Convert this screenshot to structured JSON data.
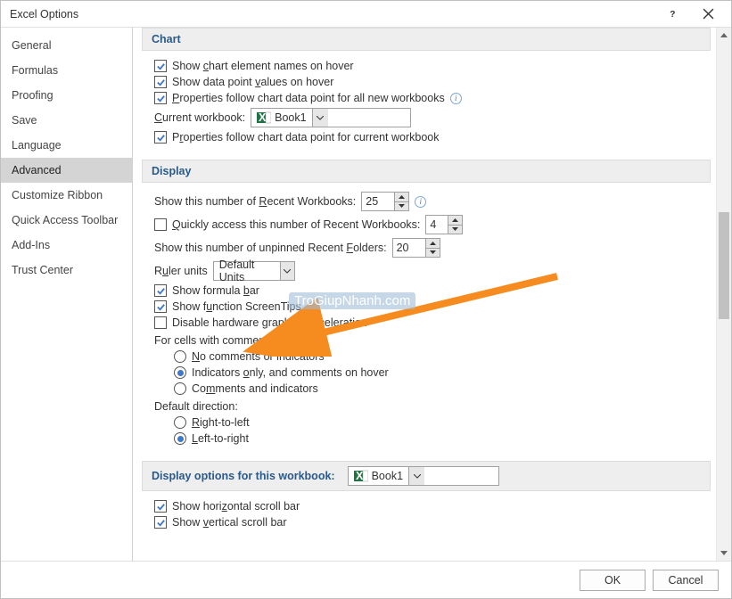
{
  "title": "Excel Options",
  "help_aria": "Help",
  "close_aria": "Close",
  "sidebar": {
    "items": [
      {
        "label": "General"
      },
      {
        "label": "Formulas"
      },
      {
        "label": "Proofing"
      },
      {
        "label": "Save"
      },
      {
        "label": "Language"
      },
      {
        "label": "Advanced"
      },
      {
        "label": "Customize Ribbon"
      },
      {
        "label": "Quick Access Toolbar"
      },
      {
        "label": "Add-Ins"
      },
      {
        "label": "Trust Center"
      }
    ],
    "selected_index": 5
  },
  "chart": {
    "header": "Chart",
    "show_names_pre": "Show ",
    "show_names_u": "c",
    "show_names_post": "hart element names on hover",
    "show_values_pre": "Show data point ",
    "show_values_u": "v",
    "show_values_post": "alues on hover",
    "props_all_pre": "",
    "props_all_u": "P",
    "props_all_post": "roperties follow chart data point for all new workbooks",
    "current_wb_pre": "",
    "current_wb_u": "C",
    "current_wb_post": "urrent workbook:",
    "current_wb_value": "Book1",
    "props_cur_pre": "P",
    "props_cur_u": "r",
    "props_cur_post": "operties follow chart data point for current workbook"
  },
  "display": {
    "header": "Display",
    "recent_wb_pre": "Show this number of ",
    "recent_wb_u": "R",
    "recent_wb_post": "ecent Workbooks:",
    "recent_wb_value": "25",
    "quick_access_pre": "",
    "quick_access_u": "Q",
    "quick_access_post": "uickly access this number of Recent Workbooks:",
    "quick_access_value": "4",
    "recent_folders_pre": "Show this number of unpinned Recent ",
    "recent_folders_u": "F",
    "recent_folders_post": "olders:",
    "recent_folders_value": "20",
    "ruler_pre": "R",
    "ruler_u": "u",
    "ruler_post": "ler units",
    "ruler_value": "Default Units",
    "formula_pre": "Show formula ",
    "formula_u": "b",
    "formula_post": "ar",
    "screentips_pre": "Show f",
    "screentips_u": "u",
    "screentips_post": "nction ScreenTips",
    "hw_pre": "Disable hardware ",
    "hw_u": "g",
    "hw_post": "raphics acceleration",
    "comments_intro": "For cells with comments, show:",
    "c_none_pre": "",
    "c_none_u": "N",
    "c_none_post": "o comments or indicators",
    "c_ind_pre": "Indicators ",
    "c_ind_u": "o",
    "c_ind_post": "nly, and comments on hover",
    "c_both_pre": "Co",
    "c_both_u": "m",
    "c_both_post": "ments and indicators",
    "dir_intro": "Default direction:",
    "rtl_pre": "",
    "rtl_u": "R",
    "rtl_post": "ight-to-left",
    "ltr_pre": "",
    "ltr_u": "L",
    "ltr_post": "eft-to-right"
  },
  "display_wb": {
    "header": "Display options for this workbook:",
    "value": "Book1",
    "hscroll_pre": "Show hori",
    "hscroll_u": "z",
    "hscroll_post": "ontal scroll bar",
    "vscroll_pre": "Show ",
    "vscroll_u": "v",
    "vscroll_post": "ertical scroll bar"
  },
  "footer": {
    "ok": "OK",
    "cancel": "Cancel"
  },
  "watermark": "TroGiupNhanh.com"
}
